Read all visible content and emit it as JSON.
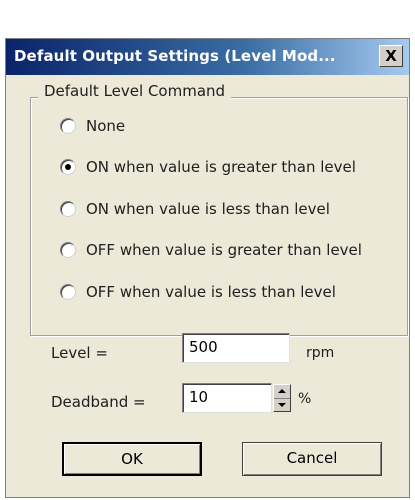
{
  "window": {
    "title": "Default Output Settings (Level Mod...",
    "close_label": "X"
  },
  "group": {
    "label": "Default Level Command",
    "options": [
      {
        "label": "None",
        "checked": false
      },
      {
        "label": "ON when value is greater than level",
        "checked": true
      },
      {
        "label": "ON when value is less than level",
        "checked": false
      },
      {
        "label": "OFF when value is greater than level",
        "checked": false
      },
      {
        "label": "OFF when value is less than level",
        "checked": false
      }
    ]
  },
  "level": {
    "label": "Level =",
    "value": "500",
    "unit": "rpm"
  },
  "deadband": {
    "label": "Deadband =",
    "value": "10",
    "unit": "%"
  },
  "buttons": {
    "ok": "OK",
    "cancel": "Cancel"
  },
  "colors": {
    "titlebar_start": "#0a246a",
    "titlebar_end": "#a6caf0",
    "dialog_bg": "#ece9d8"
  }
}
